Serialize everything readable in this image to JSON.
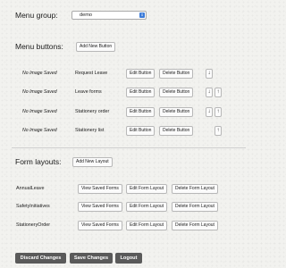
{
  "menu_group": {
    "label": "Menu group:",
    "selected": "demo"
  },
  "menu_buttons": {
    "label": "Menu buttons:",
    "add_label": "Add New Button",
    "edit_label": "Edit Button",
    "delete_label": "Delete Button",
    "items": [
      {
        "image_text": "No Image Saved",
        "name": "Request Leave"
      },
      {
        "image_text": "No Image Saved",
        "name": "Leave forms"
      },
      {
        "image_text": "No Image Saved",
        "name": "Stationery order"
      },
      {
        "image_text": "No Image Saved",
        "name": "Stationery list"
      }
    ]
  },
  "form_layouts": {
    "label": "Form layouts:",
    "add_label": "Add New Layout",
    "view_label": "View Saved Forms",
    "edit_label": "Edit Form Layout",
    "delete_label": "Delete Form Layout",
    "items": [
      {
        "name": "AnnualLeave"
      },
      {
        "name": "SafetyInitiatives"
      },
      {
        "name": "StationeryOrder"
      }
    ]
  },
  "footer": {
    "discard_label": "Discard Changes",
    "save_label": "Save Changes",
    "logout_label": "Logout"
  },
  "icons": {
    "arrow_down": "↓",
    "arrow_up": "↑",
    "select_arrows": "⇕"
  },
  "colors": {
    "footer_button": "#5a5a5a",
    "select_accent": "#3b7bd8"
  }
}
